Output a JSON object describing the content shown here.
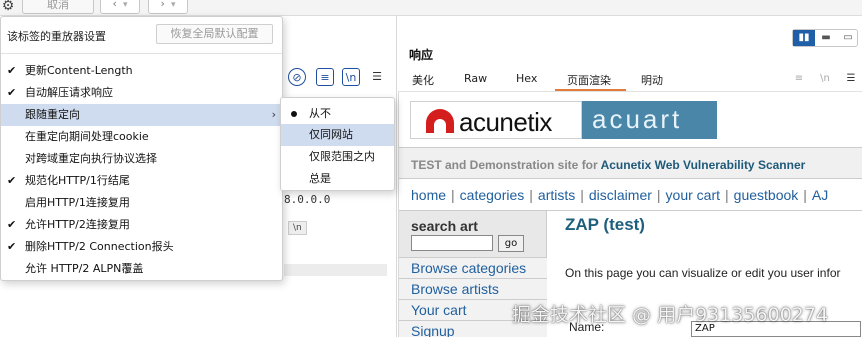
{
  "toolbar": {
    "cancel_label": "取消",
    "back_icon": "chevron-left-icon",
    "forward_icon": "chevron-right-icon",
    "settings_icon": "gear-icon"
  },
  "settings_menu": {
    "title": "该标签的重放器设置",
    "reset_button": "恢复全局默认配置",
    "items": [
      {
        "label": "更新Content-Length",
        "checked": true
      },
      {
        "label": "自动解压请求响应",
        "checked": true
      },
      {
        "label": "跟随重定向",
        "checked": false,
        "submenu": true,
        "active": true
      },
      {
        "label": "在重定向期间处理cookie",
        "checked": false
      },
      {
        "label": "对跨域重定向执行协议选择",
        "checked": false
      },
      {
        "label": "规范化HTTP/1行结尾",
        "checked": true
      },
      {
        "label": "启用HTTP/1连接复用",
        "checked": false
      },
      {
        "label": "允许HTTP/2连接复用",
        "checked": true
      },
      {
        "label": "删除HTTP/2 Connection报头",
        "checked": true
      },
      {
        "label": "允许 HTTP/2 ALPN覆盖",
        "checked": false
      }
    ]
  },
  "redirect_submenu": {
    "items": [
      {
        "label": "从不",
        "selected": true
      },
      {
        "label": "仅同网站",
        "selected": false,
        "active": true
      },
      {
        "label": "仅限范围之内",
        "selected": false
      },
      {
        "label": "总是",
        "selected": false
      }
    ]
  },
  "request_pane": {
    "host_fragment": "8.0.0.0",
    "chip": "\\n",
    "icon_newline": "\\n"
  },
  "response": {
    "title": "响应",
    "tabs": [
      "美化",
      "Raw",
      "Hex",
      "页面渲染",
      "明动"
    ],
    "active_tab": "页面渲染",
    "accent": "#e07b3a",
    "icon_newline": "\\n"
  },
  "rendered_page": {
    "logo_text": "acunetix",
    "acuart_text": "acuart",
    "tagline_prefix": "TEST and Demonstration site for ",
    "tagline_brand": "Acunetix Web Vulnerability Scanner",
    "nav": [
      "home",
      "categories",
      "artists",
      "disclaimer",
      "your cart",
      "guestbook",
      "AJ"
    ],
    "search_label": "search art",
    "go_label": "go",
    "side_links": [
      "Browse categories",
      "Browse artists",
      "Your cart",
      "Signup"
    ],
    "heading": "ZAP (test)",
    "paragraph": "On this page you can visualize or edit you user infor",
    "name_label": "Name:",
    "name_value": "ZAP"
  },
  "watermark": "掘金技术社区 @ 用户93135600274"
}
